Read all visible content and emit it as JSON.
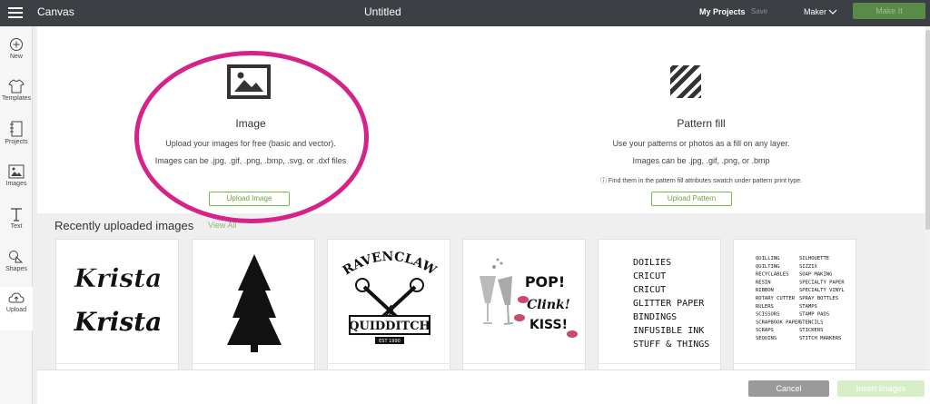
{
  "topbar": {
    "app_title": "Canvas",
    "doc_title": "Untitled",
    "my_projects": "My Projects",
    "save": "Save",
    "machine": "Maker",
    "make_it": "Make It"
  },
  "sidebar": {
    "items": [
      {
        "label": "New",
        "icon": "plus-circle-icon"
      },
      {
        "label": "Templates",
        "icon": "shirt-icon"
      },
      {
        "label": "Projects",
        "icon": "notebook-icon"
      },
      {
        "label": "Images",
        "icon": "image-icon"
      },
      {
        "label": "Text",
        "icon": "text-t-icon"
      },
      {
        "label": "Shapes",
        "icon": "shapes-icon"
      },
      {
        "label": "Upload",
        "icon": "cloud-upload-icon"
      }
    ]
  },
  "upload_image": {
    "heading": "Image",
    "line1": "Upload your images for free (basic and vector).",
    "line2": "Images can be .jpg, .gif, .png, .bmp, .svg, or .dxf files",
    "button": "Upload Image"
  },
  "pattern_fill": {
    "heading": "Pattern fill",
    "line1": "Use your patterns or photos as a fill on any layer.",
    "line2": "Images can be .jpg, .gif, .png, or .bmp",
    "note": "ⓘ Find them in the pattern fill attributes swatch under pattern print type.",
    "button": "Upload Pattern"
  },
  "recent": {
    "heading": "Recently uploaded images",
    "view_all": "View All",
    "cards": [
      {
        "text1": "Krista",
        "text2": "Krista"
      },
      {},
      {
        "top": "RAVENCLAW",
        "bottom": "QUIDDITCH",
        "est": "EST 1990"
      },
      {
        "line1": "POP!",
        "line2": "Clink!",
        "line3": "KISS!"
      },
      {
        "lines": [
          "DOILIES",
          "CRICUT",
          "CRICUT",
          "GLITTER PAPER",
          "BINDINGS",
          "INFUSIBLE INK",
          "STUFF & THINGS"
        ]
      },
      {
        "col1": [
          "QUILLING",
          "QUILTING",
          "RECYCLABLES",
          "RESIN",
          "RIBBON",
          "ROTARY CUTTER",
          "RULERS",
          "SCISSORS",
          "SCRAPBOOK PAPER",
          "SCRAPS",
          "SEQUINS"
        ],
        "col2": [
          "SILHOUETTE",
          "SIZZIX",
          "SOAP MAKING",
          "SPECIALTY PAPER",
          "SPECIALTY VINYL",
          "SPRAY BOTTLES",
          "STAMPS",
          "STAMP PADS",
          "STENCILS",
          "STICKERS",
          "STITCH MARKERS"
        ]
      }
    ]
  },
  "footer": {
    "cancel": "Cancel",
    "insert": "Insert Images"
  },
  "colors": {
    "accent_green": "#7bb34b",
    "highlight_circle": "#d6238a",
    "topbar": "#3c3f43"
  }
}
